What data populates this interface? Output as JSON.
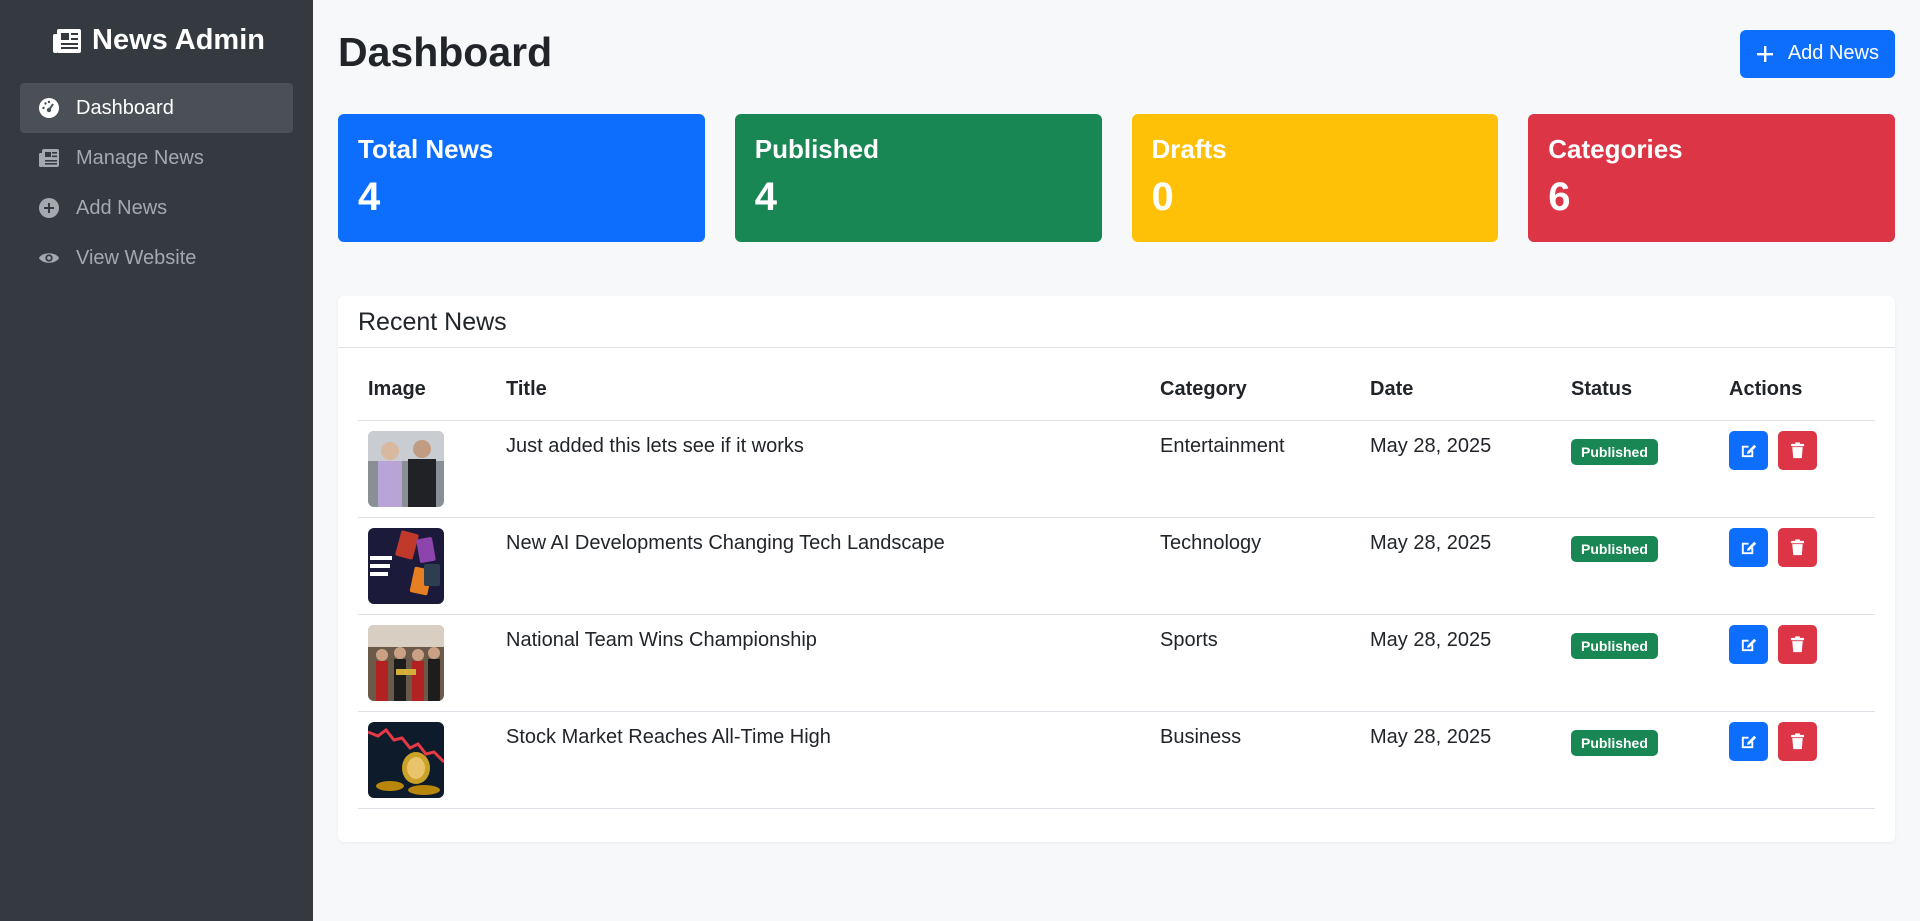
{
  "brand": {
    "title": "News Admin"
  },
  "sidebar": {
    "items": [
      {
        "label": "Dashboard",
        "icon": "gauge-icon"
      },
      {
        "label": "Manage News",
        "icon": "newspaper-icon"
      },
      {
        "label": "Add News",
        "icon": "plus-circle-icon"
      },
      {
        "label": "View Website",
        "icon": "eye-icon"
      }
    ]
  },
  "header": {
    "title": "Dashboard",
    "add_button": "Add News"
  },
  "stats": [
    {
      "label": "Total News",
      "value": "4",
      "color": "#0d6efd"
    },
    {
      "label": "Published",
      "value": "4",
      "color": "#198754"
    },
    {
      "label": "Drafts",
      "value": "0",
      "color": "#ffc107"
    },
    {
      "label": "Categories",
      "value": "6",
      "color": "#dc3545"
    }
  ],
  "recent": {
    "title": "Recent News",
    "columns": [
      "Image",
      "Title",
      "Category",
      "Date",
      "Status",
      "Actions"
    ],
    "rows": [
      {
        "title": "Just added this lets see if it works",
        "category": "Entertainment",
        "date": "May 28, 2025",
        "status": "Published"
      },
      {
        "title": "New AI Developments Changing Tech Landscape",
        "category": "Technology",
        "date": "May 28, 2025",
        "status": "Published"
      },
      {
        "title": "National Team Wins Championship",
        "category": "Sports",
        "date": "May 28, 2025",
        "status": "Published"
      },
      {
        "title": "Stock Market Reaches All-Time High",
        "category": "Business",
        "date": "May 28, 2025",
        "status": "Published"
      }
    ]
  },
  "colors": {
    "sidebar": "#343a40",
    "primary": "#0d6efd",
    "success": "#198754",
    "danger": "#dc3545"
  }
}
